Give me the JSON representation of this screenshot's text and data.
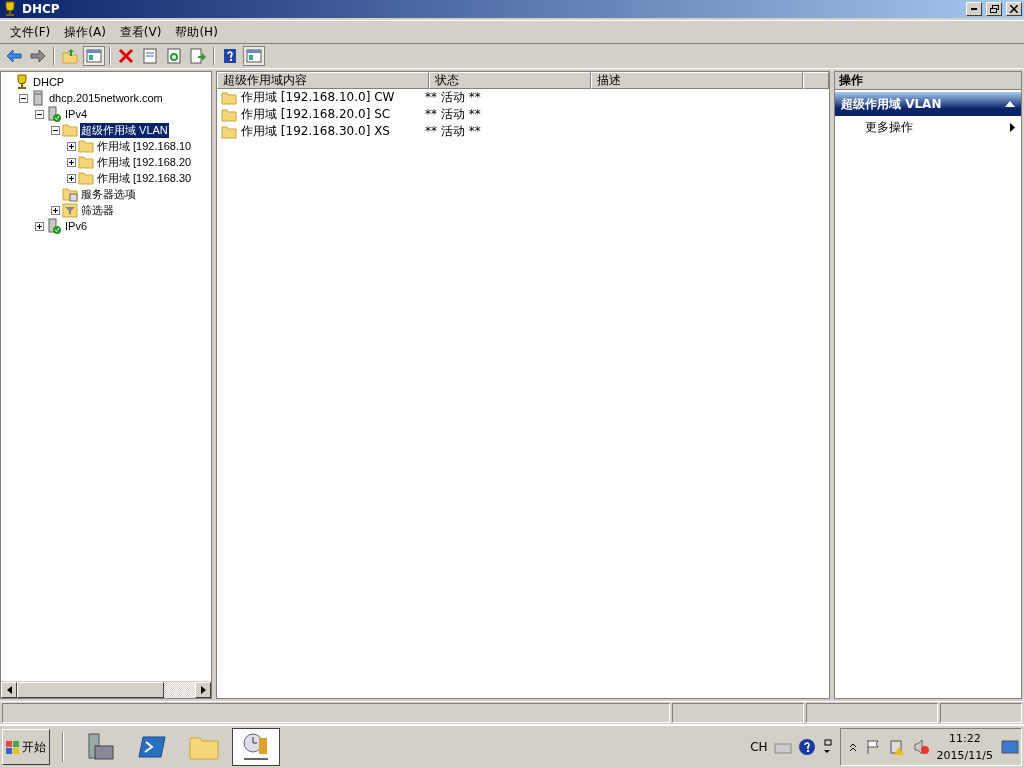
{
  "window": {
    "title": "DHCP"
  },
  "menu": [
    "文件(F)",
    "操作(A)",
    "查看(V)",
    "帮助(H)"
  ],
  "toolbar": [
    {
      "kind": "back"
    },
    {
      "kind": "forward"
    },
    {
      "kind": "sep"
    },
    {
      "kind": "up"
    },
    {
      "kind": "pane",
      "selected": true
    },
    {
      "kind": "sep"
    },
    {
      "kind": "delete"
    },
    {
      "kind": "props"
    },
    {
      "kind": "refresh"
    },
    {
      "kind": "export"
    },
    {
      "kind": "sep"
    },
    {
      "kind": "help"
    },
    {
      "kind": "pane",
      "selected": true
    }
  ],
  "tree": [
    {
      "label": "DHCP",
      "kind": "root",
      "selected": false,
      "children": [
        {
          "label": "dhcp.2015network.com",
          "kind": "server",
          "expanded": true,
          "selected": false,
          "children": [
            {
              "label": "IPv4",
              "kind": "ip",
              "expanded": true,
              "selected": false,
              "children": [
                {
                  "label": "超级作用域 VLAN",
                  "kind": "folder",
                  "expanded": true,
                  "selected": true,
                  "children": [
                    {
                      "label": "作用域 [192.168.10",
                      "kind": "folder",
                      "expanded": false,
                      "selected": false
                    },
                    {
                      "label": "作用域 [192.168.20",
                      "kind": "folder",
                      "expanded": false,
                      "selected": false
                    },
                    {
                      "label": "作用域 [192.168.30",
                      "kind": "folder",
                      "expanded": false,
                      "selected": false
                    }
                  ]
                },
                {
                  "label": "服务器选项",
                  "kind": "options",
                  "selected": false
                },
                {
                  "label": "筛选器",
                  "kind": "filter",
                  "expanded": false,
                  "selected": false
                }
              ]
            },
            {
              "label": "IPv6",
              "kind": "ip",
              "expanded": false,
              "selected": false
            }
          ]
        }
      ]
    }
  ],
  "table": {
    "columns": [
      "超级作用域内容",
      "状态",
      "描述"
    ],
    "rows": [
      {
        "name": "作用域 [192.168.10.0] CW",
        "status": "** 活动 **"
      },
      {
        "name": "作用域 [192.168.20.0] SC",
        "status": "** 活动 **"
      },
      {
        "name": "作用域 [192.168.30.0] XS",
        "status": "** 活动 **"
      }
    ]
  },
  "actions": {
    "title": "操作",
    "section": "超级作用域 VLAN",
    "items": [
      "更多操作"
    ]
  },
  "taskbar": {
    "start": "开始",
    "apps": [
      {
        "kind": "tools",
        "selected": false
      },
      {
        "kind": "shell",
        "selected": false
      },
      {
        "kind": "explorer",
        "selected": false
      },
      {
        "kind": "dhcp",
        "selected": true
      }
    ],
    "language": "CH",
    "time": "11:22",
    "date": "2015/11/5"
  }
}
